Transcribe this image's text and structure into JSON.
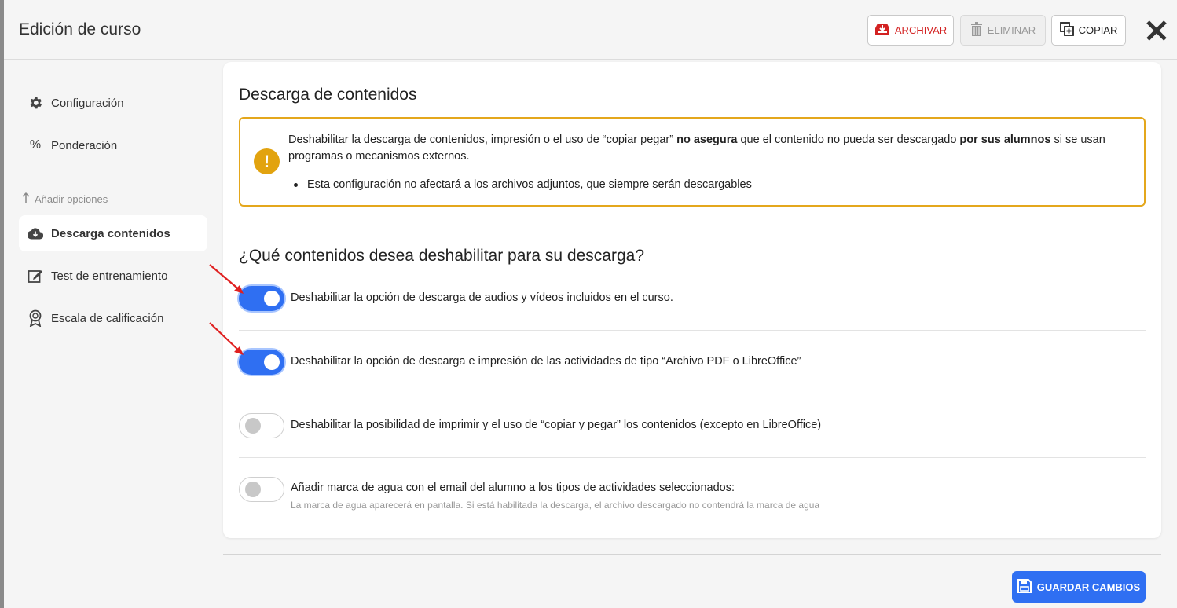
{
  "header": {
    "title": "Edición de curso",
    "archive_label": "ARCHIVAR",
    "delete_label": "ELIMINAR",
    "copy_label": "COPIAR"
  },
  "sidebar": {
    "items": [
      {
        "label": "Configuración",
        "icon": "gear-icon"
      },
      {
        "label": "Ponderación",
        "icon": "percent-icon"
      }
    ],
    "section_label": "Añadir opciones",
    "options": [
      {
        "label": "Descarga contenidos",
        "icon": "cloud-download-icon",
        "active": true
      },
      {
        "label": "Test de entrenamiento",
        "icon": "edit-note-icon"
      },
      {
        "label": "Escala de calificación",
        "icon": "award-icon"
      }
    ]
  },
  "card": {
    "title": "Descarga de contenidos",
    "warning": {
      "text_1": "Deshabilitar la descarga de contenidos, impresión o el uso de “copiar pegar” ",
      "bold_1": "no asegura",
      "text_2": " que el contenido no pueda ser descargado ",
      "bold_2": "por sus alumnos",
      "text_3": " si se usan programas o mecanismos externos.",
      "bullet": "Esta configuración no afectará a los archivos adjuntos, que siempre serán descargables"
    },
    "question": "¿Qué contenidos desea deshabilitar para su descarga?",
    "options": [
      {
        "label": "Deshabilitar la opción de descarga de audios y vídeos incluidos en el curso.",
        "enabled": true
      },
      {
        "label": "Deshabilitar la opción de descarga e impresión de las actividades de tipo “Archivo PDF o LibreOffice”",
        "enabled": true
      },
      {
        "label": "Deshabilitar la posibilidad de imprimir y el uso de “copiar y pegar” los contenidos (excepto en LibreOffice)",
        "enabled": false
      },
      {
        "label": "Añadir marca de agua con el email del alumno a los tipos de actividades seleccionados:",
        "note": "La marca de agua aparecerá en pantalla. Si está habilitada la descarga, el archivo descargado no contendrá la marca de agua",
        "enabled": false
      }
    ]
  },
  "footer": {
    "save_label": "GUARDAR CAMBIOS"
  },
  "colors": {
    "primary": "#2f6ff2",
    "danger": "#d32222",
    "warning": "#e4a71c",
    "annotation_arrow": "#e02020"
  }
}
